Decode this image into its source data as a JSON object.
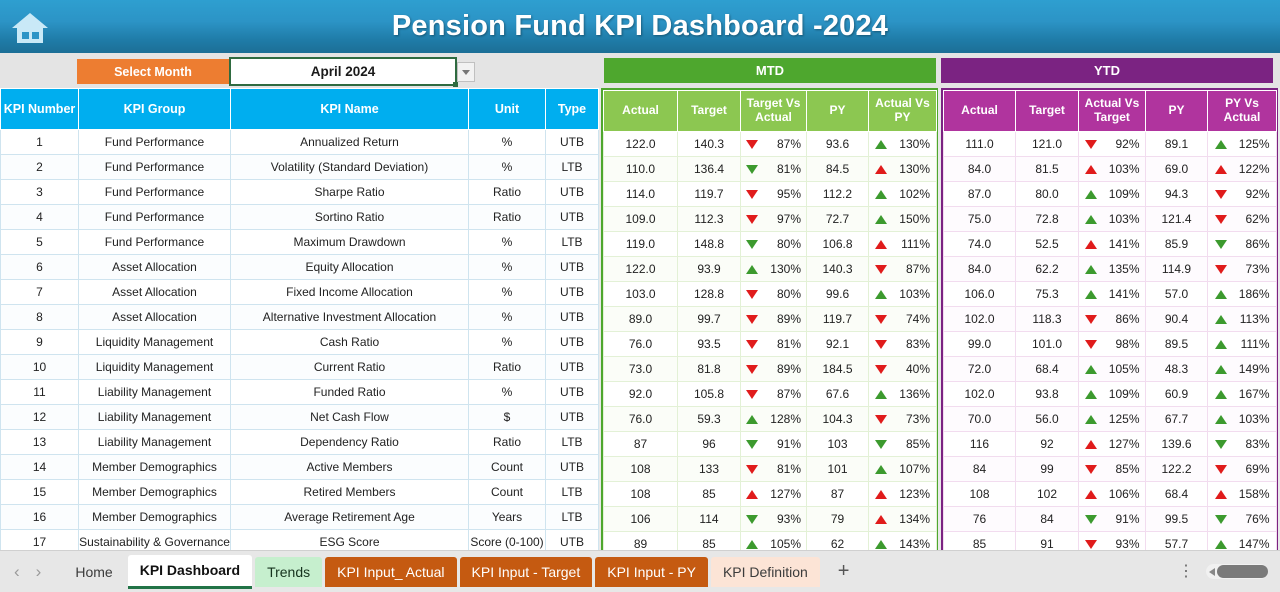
{
  "titlebar": {
    "home_icon": "home-icon",
    "title": "Pension Fund KPI Dashboard -2024",
    "accent": "#2c94c6"
  },
  "controls": {
    "select_month_label": "Select Month",
    "selected_month": "April 2024",
    "dropdown_icon": "chevron-down-icon",
    "label_color": "#ed7d31",
    "box_border_color": "#2f6b40"
  },
  "bands": {
    "mtd": {
      "label": "MTD",
      "color": "#4ea72e"
    },
    "ytd": {
      "label": "YTD",
      "color": "#7b2382"
    }
  },
  "left_headers": [
    "KPI\nNumber",
    "KPI Group",
    "KPI Name",
    "Unit",
    "Type"
  ],
  "left_headers_flat": {
    "number": "KPI Number",
    "group": "KPI Group",
    "name": "KPI Name",
    "unit": "Unit",
    "type": "Type"
  },
  "mtd_headers": [
    "Actual",
    "Target",
    "Target Vs Actual",
    "PY",
    "Actual Vs PY"
  ],
  "ytd_headers": [
    "Actual",
    "Target",
    "Actual Vs Target",
    "PY",
    "PY Vs Actual"
  ],
  "chart_data": {
    "type": "table",
    "title": "Pension Fund KPI Dashboard -2024",
    "period": "April 2024",
    "columns": [
      "KPI Number",
      "KPI Group",
      "KPI Name",
      "Unit",
      "Type",
      "MTD Actual",
      "MTD Target",
      "MTD Target Vs Actual",
      "MTD PY",
      "MTD Actual Vs PY",
      "YTD Actual",
      "YTD Target",
      "YTD Actual Vs Target",
      "YTD PY",
      "YTD PY Vs Actual"
    ],
    "rows": [
      {
        "number": "1",
        "group": "Fund Performance",
        "name": "Annualized Return",
        "unit": "%",
        "type": "UTB",
        "mtd": {
          "actual": "122.0",
          "target": "140.3",
          "tva": {
            "v": "87%",
            "dir": "down",
            "color": "red"
          },
          "py": "93.6",
          "avp": {
            "v": "130%",
            "dir": "up",
            "color": "green"
          }
        },
        "ytd": {
          "actual": "111.0",
          "target": "121.0",
          "avt": {
            "v": "92%",
            "dir": "down",
            "color": "red"
          },
          "py": "89.1",
          "pva": {
            "v": "125%",
            "dir": "up",
            "color": "green"
          }
        }
      },
      {
        "number": "2",
        "group": "Fund Performance",
        "name": "Volatility (Standard Deviation)",
        "unit": "%",
        "type": "LTB",
        "mtd": {
          "actual": "110.0",
          "target": "136.4",
          "tva": {
            "v": "81%",
            "dir": "down",
            "color": "green"
          },
          "py": "84.5",
          "avp": {
            "v": "130%",
            "dir": "up",
            "color": "red"
          }
        },
        "ytd": {
          "actual": "84.0",
          "target": "81.5",
          "avt": {
            "v": "103%",
            "dir": "up",
            "color": "red"
          },
          "py": "69.0",
          "pva": {
            "v": "122%",
            "dir": "up",
            "color": "red"
          }
        }
      },
      {
        "number": "3",
        "group": "Fund Performance",
        "name": "Sharpe Ratio",
        "unit": "Ratio",
        "type": "UTB",
        "mtd": {
          "actual": "114.0",
          "target": "119.7",
          "tva": {
            "v": "95%",
            "dir": "down",
            "color": "red"
          },
          "py": "112.2",
          "avp": {
            "v": "102%",
            "dir": "up",
            "color": "green"
          }
        },
        "ytd": {
          "actual": "87.0",
          "target": "80.0",
          "avt": {
            "v": "109%",
            "dir": "up",
            "color": "green"
          },
          "py": "94.3",
          "pva": {
            "v": "92%",
            "dir": "down",
            "color": "red"
          }
        }
      },
      {
        "number": "4",
        "group": "Fund Performance",
        "name": "Sortino Ratio",
        "unit": "Ratio",
        "type": "UTB",
        "mtd": {
          "actual": "109.0",
          "target": "112.3",
          "tva": {
            "v": "97%",
            "dir": "down",
            "color": "red"
          },
          "py": "72.7",
          "avp": {
            "v": "150%",
            "dir": "up",
            "color": "green"
          }
        },
        "ytd": {
          "actual": "75.0",
          "target": "72.8",
          "avt": {
            "v": "103%",
            "dir": "up",
            "color": "green"
          },
          "py": "121.4",
          "pva": {
            "v": "62%",
            "dir": "down",
            "color": "red"
          }
        }
      },
      {
        "number": "5",
        "group": "Fund Performance",
        "name": "Maximum Drawdown",
        "unit": "%",
        "type": "LTB",
        "mtd": {
          "actual": "119.0",
          "target": "148.8",
          "tva": {
            "v": "80%",
            "dir": "down",
            "color": "green"
          },
          "py": "106.8",
          "avp": {
            "v": "111%",
            "dir": "up",
            "color": "red"
          }
        },
        "ytd": {
          "actual": "74.0",
          "target": "52.5",
          "avt": {
            "v": "141%",
            "dir": "up",
            "color": "red"
          },
          "py": "85.9",
          "pva": {
            "v": "86%",
            "dir": "down",
            "color": "green"
          }
        }
      },
      {
        "number": "6",
        "group": "Asset Allocation",
        "name": "Equity Allocation",
        "unit": "%",
        "type": "UTB",
        "mtd": {
          "actual": "122.0",
          "target": "93.9",
          "tva": {
            "v": "130%",
            "dir": "up",
            "color": "green"
          },
          "py": "140.3",
          "avp": {
            "v": "87%",
            "dir": "down",
            "color": "red"
          }
        },
        "ytd": {
          "actual": "84.0",
          "target": "62.2",
          "avt": {
            "v": "135%",
            "dir": "up",
            "color": "green"
          },
          "py": "114.9",
          "pva": {
            "v": "73%",
            "dir": "down",
            "color": "red"
          }
        }
      },
      {
        "number": "7",
        "group": "Asset Allocation",
        "name": "Fixed Income Allocation",
        "unit": "%",
        "type": "UTB",
        "mtd": {
          "actual": "103.0",
          "target": "128.8",
          "tva": {
            "v": "80%",
            "dir": "down",
            "color": "red"
          },
          "py": "99.6",
          "avp": {
            "v": "103%",
            "dir": "up",
            "color": "green"
          }
        },
        "ytd": {
          "actual": "106.0",
          "target": "75.3",
          "avt": {
            "v": "141%",
            "dir": "up",
            "color": "green"
          },
          "py": "57.0",
          "pva": {
            "v": "186%",
            "dir": "up",
            "color": "green"
          }
        }
      },
      {
        "number": "8",
        "group": "Asset Allocation",
        "name": "Alternative Investment Allocation",
        "unit": "%",
        "type": "UTB",
        "mtd": {
          "actual": "89.0",
          "target": "99.7",
          "tva": {
            "v": "89%",
            "dir": "down",
            "color": "red"
          },
          "py": "119.7",
          "avp": {
            "v": "74%",
            "dir": "down",
            "color": "red"
          }
        },
        "ytd": {
          "actual": "102.0",
          "target": "118.3",
          "avt": {
            "v": "86%",
            "dir": "down",
            "color": "red"
          },
          "py": "90.4",
          "pva": {
            "v": "113%",
            "dir": "up",
            "color": "green"
          }
        }
      },
      {
        "number": "9",
        "group": "Liquidity Management",
        "name": "Cash Ratio",
        "unit": "%",
        "type": "UTB",
        "mtd": {
          "actual": "76.0",
          "target": "93.5",
          "tva": {
            "v": "81%",
            "dir": "down",
            "color": "red"
          },
          "py": "92.1",
          "avp": {
            "v": "83%",
            "dir": "down",
            "color": "red"
          }
        },
        "ytd": {
          "actual": "99.0",
          "target": "101.0",
          "avt": {
            "v": "98%",
            "dir": "down",
            "color": "red"
          },
          "py": "89.5",
          "pva": {
            "v": "111%",
            "dir": "up",
            "color": "green"
          }
        }
      },
      {
        "number": "10",
        "group": "Liquidity Management",
        "name": "Current Ratio",
        "unit": "Ratio",
        "type": "UTB",
        "mtd": {
          "actual": "73.0",
          "target": "81.8",
          "tva": {
            "v": "89%",
            "dir": "down",
            "color": "red"
          },
          "py": "184.5",
          "avp": {
            "v": "40%",
            "dir": "down",
            "color": "red"
          }
        },
        "ytd": {
          "actual": "72.0",
          "target": "68.4",
          "avt": {
            "v": "105%",
            "dir": "up",
            "color": "green"
          },
          "py": "48.3",
          "pva": {
            "v": "149%",
            "dir": "up",
            "color": "green"
          }
        }
      },
      {
        "number": "11",
        "group": "Liability Management",
        "name": "Funded Ratio",
        "unit": "%",
        "type": "UTB",
        "mtd": {
          "actual": "92.0",
          "target": "105.8",
          "tva": {
            "v": "87%",
            "dir": "down",
            "color": "red"
          },
          "py": "67.6",
          "avp": {
            "v": "136%",
            "dir": "up",
            "color": "green"
          }
        },
        "ytd": {
          "actual": "102.0",
          "target": "93.8",
          "avt": {
            "v": "109%",
            "dir": "up",
            "color": "green"
          },
          "py": "60.9",
          "pva": {
            "v": "167%",
            "dir": "up",
            "color": "green"
          }
        }
      },
      {
        "number": "12",
        "group": "Liability Management",
        "name": "Net Cash Flow",
        "unit": "$",
        "type": "UTB",
        "mtd": {
          "actual": "76.0",
          "target": "59.3",
          "tva": {
            "v": "128%",
            "dir": "up",
            "color": "green"
          },
          "py": "104.3",
          "avp": {
            "v": "73%",
            "dir": "down",
            "color": "red"
          }
        },
        "ytd": {
          "actual": "70.0",
          "target": "56.0",
          "avt": {
            "v": "125%",
            "dir": "up",
            "color": "green"
          },
          "py": "67.7",
          "pva": {
            "v": "103%",
            "dir": "up",
            "color": "green"
          }
        }
      },
      {
        "number": "13",
        "group": "Liability Management",
        "name": "Dependency Ratio",
        "unit": "Ratio",
        "type": "LTB",
        "mtd": {
          "actual": "87",
          "target": "96",
          "tva": {
            "v": "91%",
            "dir": "down",
            "color": "green"
          },
          "py": "103",
          "avp": {
            "v": "85%",
            "dir": "down",
            "color": "green"
          }
        },
        "ytd": {
          "actual": "116",
          "target": "92",
          "avt": {
            "v": "127%",
            "dir": "up",
            "color": "red"
          },
          "py": "139.6",
          "pva": {
            "v": "83%",
            "dir": "down",
            "color": "green"
          }
        }
      },
      {
        "number": "14",
        "group": "Member Demographics",
        "name": "Active Members",
        "unit": "Count",
        "type": "UTB",
        "mtd": {
          "actual": "108",
          "target": "133",
          "tva": {
            "v": "81%",
            "dir": "down",
            "color": "red"
          },
          "py": "101",
          "avp": {
            "v": "107%",
            "dir": "up",
            "color": "green"
          }
        },
        "ytd": {
          "actual": "84",
          "target": "99",
          "avt": {
            "v": "85%",
            "dir": "down",
            "color": "red"
          },
          "py": "122.2",
          "pva": {
            "v": "69%",
            "dir": "down",
            "color": "red"
          }
        }
      },
      {
        "number": "15",
        "group": "Member Demographics",
        "name": "Retired Members",
        "unit": "Count",
        "type": "LTB",
        "mtd": {
          "actual": "108",
          "target": "85",
          "tva": {
            "v": "127%",
            "dir": "up",
            "color": "red"
          },
          "py": "87",
          "avp": {
            "v": "123%",
            "dir": "up",
            "color": "red"
          }
        },
        "ytd": {
          "actual": "108",
          "target": "102",
          "avt": {
            "v": "106%",
            "dir": "up",
            "color": "red"
          },
          "py": "68.4",
          "pva": {
            "v": "158%",
            "dir": "up",
            "color": "red"
          }
        }
      },
      {
        "number": "16",
        "group": "Member Demographics",
        "name": "Average Retirement Age",
        "unit": "Years",
        "type": "LTB",
        "mtd": {
          "actual": "106",
          "target": "114",
          "tva": {
            "v": "93%",
            "dir": "down",
            "color": "green"
          },
          "py": "79",
          "avp": {
            "v": "134%",
            "dir": "up",
            "color": "red"
          }
        },
        "ytd": {
          "actual": "76",
          "target": "84",
          "avt": {
            "v": "91%",
            "dir": "down",
            "color": "green"
          },
          "py": "99.5",
          "pva": {
            "v": "76%",
            "dir": "down",
            "color": "green"
          }
        }
      },
      {
        "number": "17",
        "group": "Sustainability & Governance",
        "name": "ESG Score",
        "unit": "Score (0-100)",
        "type": "UTB",
        "mtd": {
          "actual": "89",
          "target": "85",
          "tva": {
            "v": "105%",
            "dir": "up",
            "color": "green"
          },
          "py": "62",
          "avp": {
            "v": "143%",
            "dir": "up",
            "color": "green"
          }
        },
        "ytd": {
          "actual": "85",
          "target": "91",
          "avt": {
            "v": "93%",
            "dir": "down",
            "color": "red"
          },
          "py": "57.7",
          "pva": {
            "v": "147%",
            "dir": "up",
            "color": "green"
          }
        }
      }
    ]
  },
  "tabbar": {
    "prev_icon": "chevron-left-icon",
    "next_icon": "chevron-right-icon",
    "tabs": [
      {
        "label": "Home",
        "style": "plain"
      },
      {
        "label": "KPI Dashboard",
        "style": "active"
      },
      {
        "label": "Trends",
        "style": "green"
      },
      {
        "label": "KPI Input_ Actual",
        "style": "orange"
      },
      {
        "label": "KPI Input - Target",
        "style": "orange"
      },
      {
        "label": "KPI Input - PY",
        "style": "orange"
      },
      {
        "label": "KPI Definition",
        "style": "peach"
      }
    ],
    "add_sheet_icon": "plus-icon",
    "more_icon": "kebab-menu-icon",
    "hscroll_icon": "horizontal-scrollbar"
  }
}
